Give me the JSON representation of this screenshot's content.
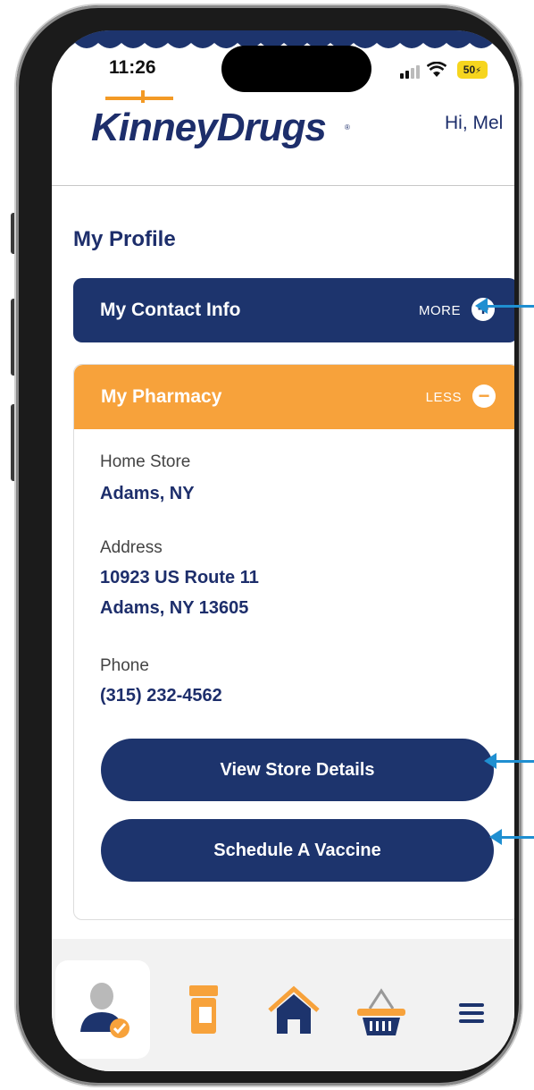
{
  "status_bar": {
    "time": "11:26",
    "battery": "50"
  },
  "header": {
    "logo_text": "KinneyDrugs",
    "greeting": "Hi, Mel"
  },
  "page": {
    "title": "My Profile"
  },
  "contact_info": {
    "title": "My Contact Info",
    "action_label": "MORE",
    "action_icon": "plus-icon",
    "expanded": false
  },
  "pharmacy": {
    "title": "My Pharmacy",
    "action_label": "LESS",
    "action_icon": "minus-icon",
    "expanded": true,
    "home_store_label": "Home Store",
    "home_store_value": "Adams, NY",
    "address_label": "Address",
    "address_line1": "10923 US Route 11",
    "address_line2": "Adams, NY 13605",
    "phone_label": "Phone",
    "phone_value": "(315) 232-4562",
    "view_store_button": "View Store Details",
    "schedule_vaccine_button": "Schedule A Vaccine"
  },
  "bottom_nav": {
    "items": [
      {
        "icon": "profile-icon",
        "active": true
      },
      {
        "icon": "prescription-bottle-icon",
        "active": false
      },
      {
        "icon": "home-icon",
        "active": false
      },
      {
        "icon": "shopping-basket-icon",
        "active": false
      },
      {
        "icon": "menu-icon",
        "active": false
      }
    ]
  },
  "colors": {
    "navy": "#1d346d",
    "orange": "#f7a23b",
    "annotation_arrow": "#1f8fd1"
  }
}
